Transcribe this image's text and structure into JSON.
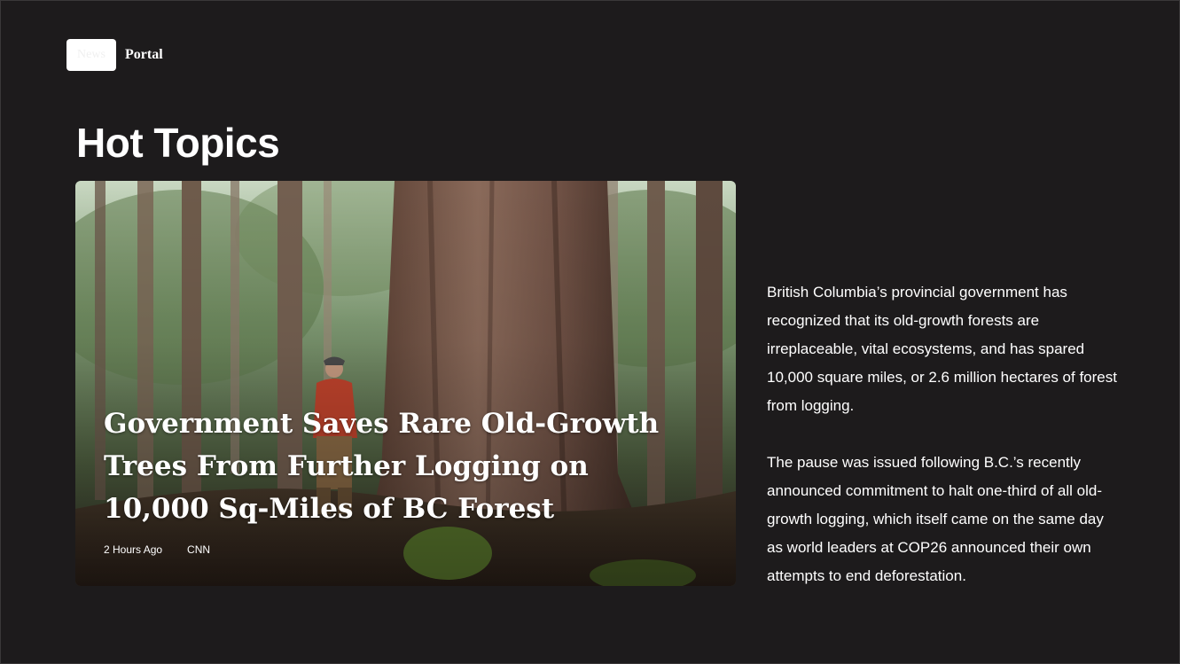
{
  "header": {
    "logo_badge_text": "News",
    "logo_text": "Portal"
  },
  "section": {
    "title": "Hot Topics"
  },
  "featured": {
    "headline": "Government Saves Rare Old-Growth Trees From Further Logging on 10,000 Sq-Miles of BC Forest",
    "time": "2 Hours Ago",
    "source": "CNN",
    "image_description": "person-beside-giant-old-growth-tree"
  },
  "article": {
    "paragraphs": [
      "British Columbia’s provincial government has recognized that its old-growth forests are irreplaceable, vital ecosystems, and has spared 10,000 square miles, or 2.6 million hectares of forest from logging.",
      "The pause was issued following B.C.’s recently announced commitment to halt one-third of all old-growth logging, which itself came on the same day as world leaders at COP26 announced their own attempts to end deforestation."
    ]
  },
  "colors": {
    "background": "#1d1b1c",
    "text": "#ffffff"
  }
}
